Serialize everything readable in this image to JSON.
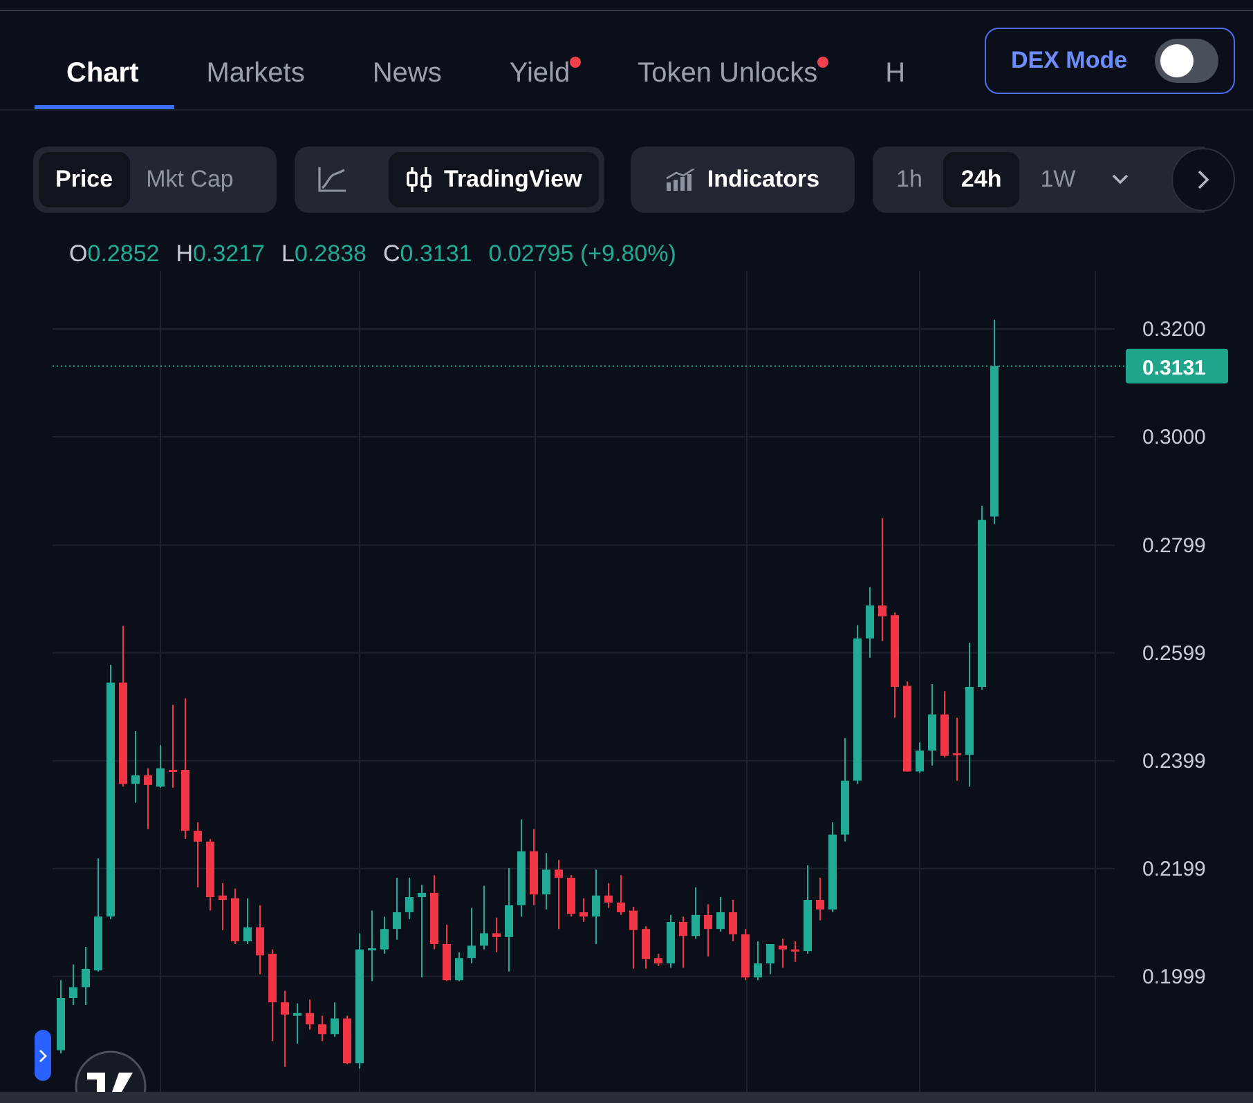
{
  "tabs": [
    {
      "label": "Chart",
      "selected": true,
      "badge": false
    },
    {
      "label": "Markets",
      "selected": false,
      "badge": false
    },
    {
      "label": "News",
      "selected": false,
      "badge": false
    },
    {
      "label": "Yield",
      "selected": false,
      "badge": true
    },
    {
      "label": "Token Unlocks",
      "selected": false,
      "badge": true
    },
    {
      "label": "H",
      "selected": false,
      "badge": false
    }
  ],
  "dex_mode": {
    "label": "DEX Mode",
    "on": false
  },
  "value_mode": [
    {
      "label": "Price",
      "selected": true
    },
    {
      "label": "Mkt Cap",
      "selected": false
    }
  ],
  "chart_style": [
    {
      "kind": "line",
      "selected": false
    },
    {
      "kind": "candles",
      "label": "TradingView",
      "selected": true
    }
  ],
  "indicators_button": {
    "label": "Indicators"
  },
  "timeframes": [
    {
      "label": "1h",
      "selected": false
    },
    {
      "label": "24h",
      "selected": true
    },
    {
      "label": "1W",
      "selected": false
    }
  ],
  "ohlc": [
    {
      "key": "O",
      "value": "0.2852"
    },
    {
      "key": "H",
      "value": "0.3217"
    },
    {
      "key": "L",
      "value": "0.2838"
    },
    {
      "key": "C",
      "value": "0.3131"
    }
  ],
  "change": "0.02795 (+9.80%)",
  "price_axis": [
    "0.3200",
    "0.3000",
    "0.2799",
    "0.2599",
    "0.2399",
    "0.2199",
    "0.1999"
  ],
  "current_price": "0.3131"
}
